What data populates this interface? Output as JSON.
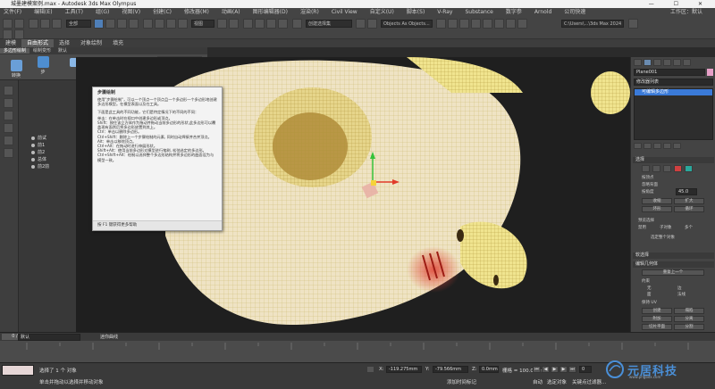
{
  "window": {
    "title": "城墨建模案例.max - Autodesk 3ds Max Olympus",
    "controls": "— ☐ ✕"
  },
  "menu": [
    "文件(F)",
    "编辑(E)",
    "工具(T)",
    "组(G)",
    "视图(V)",
    "创建(C)",
    "修改器(M)",
    "动画(A)",
    "图形编辑器(D)",
    "渲染(R)",
    "Civil View",
    "自定义(U)",
    "脚本(S)",
    "V-Ray",
    "Substance",
    "数字参",
    "Arnold",
    "公司快速"
  ],
  "menu_right": "工作区：默认",
  "toolbar": {
    "selection_filter": "全部",
    "view_dropdown": "视图",
    "selection_set": "创建选择集",
    "named_objects": "Objects As Objects...",
    "path": "C:\\Users\\...\\3ds Max 2024"
  },
  "ribbon_tabs": [
    "建模",
    "自由形式",
    "选择",
    "对象绘制",
    "填充"
  ],
  "ribbon_active_tab": "自由形式",
  "ribbon_subtabs": [
    "多边形绘制",
    "绘制变形",
    "默认"
  ],
  "ribbon_items": [
    "推/拉",
    "移动",
    "绘制",
    "凸出",
    "松弛",
    "图形",
    "拓扑",
    "步骤曲面",
    "形状",
    "",
    ""
  ],
  "ribbon_labels": {
    "convert": "转换",
    "step": "步",
    "topology": "拓扑",
    "brush": "绘制",
    "smooth": "平滑",
    "brush2": "笔刷"
  },
  "tooltip": {
    "title": "步骤绘制",
    "body1": "使用\"步骤绘制\"，可以一个顶点一个顶点且一个多边形一个多边形地创建多边形模型。在模型表面以及在工具。",
    "body2": "下面是此工具的不同功能，它们是特定情况下的不同的不同：",
    "bullets": [
      "单击：在单击时在视口中创建多边形或顶点。",
      "Shift：按住该立方体作为拖动并拖动当前多边形的形状,此多边形可以覆盖现有面然后将多边形放置到其上。",
      "Ctrl：单击以删除多边形。",
      "Ctrl+Shift：删除上一个步骤绘制的元素, 同时自动焊接并合并顶点。",
      "Alt：单击以移除顶点。",
      "Ctrl+Alt：在拖动时进行伸展形状。",
      "Shift+Alt：使用当前多边形对模型进行笔刷, 松弛选定的多边形。",
      "Ctrl+Shift+Alt：绘制以选择整个多边形结构并将多边形的曲面设为与模型一致。"
    ],
    "footer": "按 F1 键获得更多帮助"
  },
  "scene_explorer": {
    "items": [
      "前试",
      "前1",
      "前2",
      "总体",
      "前2前"
    ]
  },
  "right_panel": {
    "object_name": "Plane001",
    "modifier_list": "修改器列表",
    "modifier_stack": [
      "可编辑多边形"
    ],
    "sections": {
      "selection": "选择",
      "by_vertex": "按顶点",
      "ignore_backfacing": "忽略背面",
      "by_angle": "按角度",
      "angle_value": "45.0",
      "shrink": "收缩",
      "grow": "扩大",
      "ring": "环形",
      "loop": "循环",
      "preview_selection": "预览选择",
      "off": "禁用",
      "subobject": "子对象",
      "multi": "多个",
      "selected_count": "选定整个对象",
      "soft_selection": "软选择",
      "edit_geometry": "编辑几何体",
      "repeat_last": "重复上一个",
      "constraints": "约束",
      "none": "无",
      "edge": "边",
      "face": "面",
      "normal": "法线",
      "preserve_uvs": "保持 UV",
      "create": "创建",
      "collapse": "塌陷",
      "attach": "附加",
      "detach": "分离",
      "slice_plane": "切片平面",
      "split": "分割",
      "slice": "切片",
      "reset_plane": "重置平面",
      "quickslice": "快速切片",
      "cut": "切割"
    }
  },
  "timeline": {
    "frame": "0 / 100"
  },
  "status": {
    "default_layer": "默认",
    "selection_info": "选择了 1 个 对象",
    "prompt": "单击并拖动以选择并移动对象",
    "x_label": "X:",
    "x_value": "-119.275mm",
    "y_label": "Y:",
    "y_value": "-79.566mm",
    "z_label": "Z:",
    "z_value": "0.0mm",
    "grid": "栅格 = 100.0mm",
    "addtime": "添加时间标记",
    "auto_key": "自动",
    "set_key": "设置关键点",
    "selected": "选定对象",
    "filters": "关键点过滤器...",
    "frame_value": "0",
    "track_label": "迷你曲线"
  },
  "watermark": {
    "text": "元居科技",
    "url": "www.pngbox.com"
  },
  "colors": {
    "tooltip_bg": "#f3f3f3",
    "mesh_yellow": "#e8d46a",
    "mesh_cream": "#f1e6c6",
    "accent_blue": "#3a7ad8",
    "watermark_blue": "#4a90d9"
  }
}
